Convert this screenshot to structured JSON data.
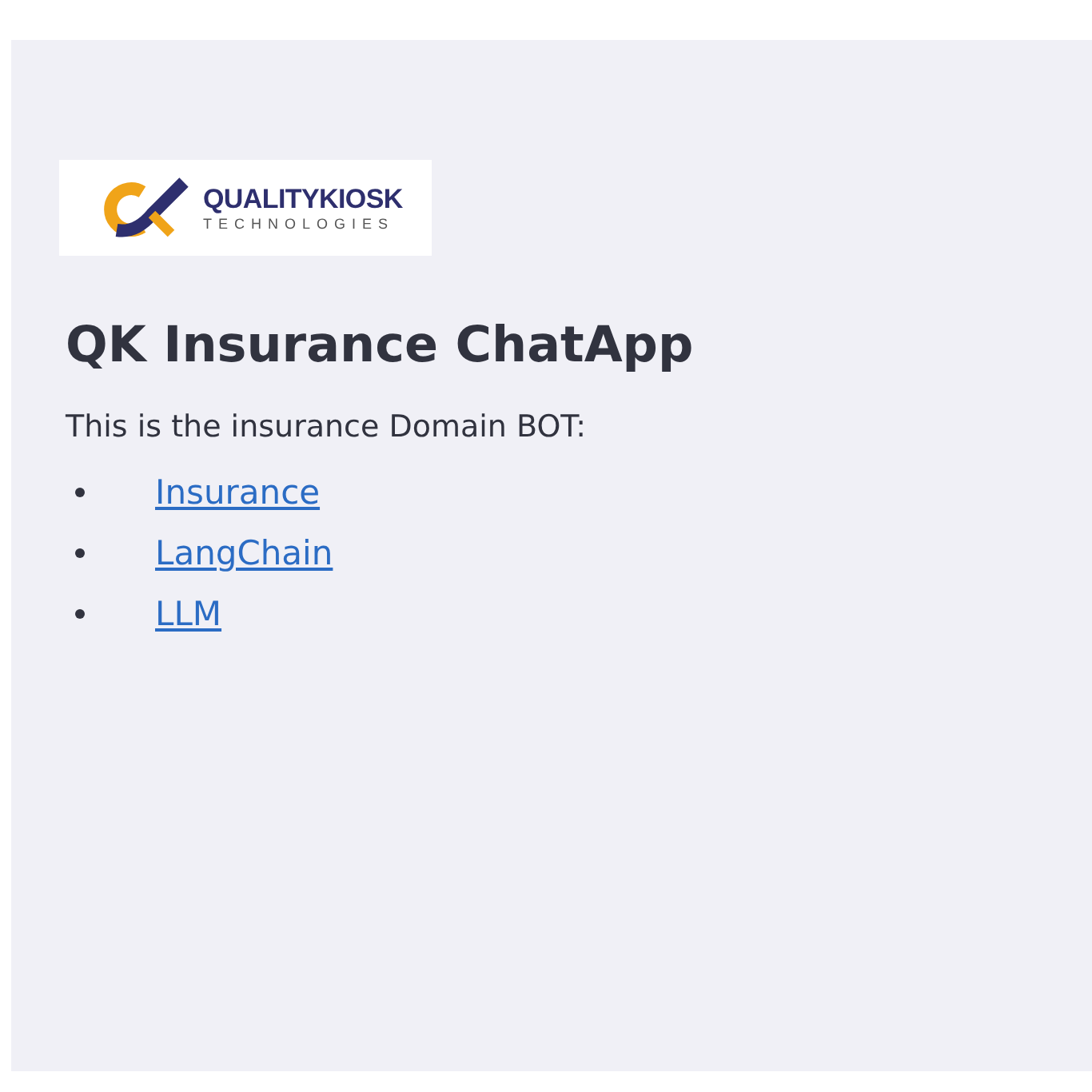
{
  "logo": {
    "name": "QUALITYKIOSK",
    "tagline": "TECHNOLOGIES"
  },
  "title": "QK Insurance ChatApp",
  "intro": "This is the insurance Domain BOT:",
  "links": [
    {
      "label": "Insurance"
    },
    {
      "label": "LangChain"
    },
    {
      "label": "LLM"
    }
  ]
}
